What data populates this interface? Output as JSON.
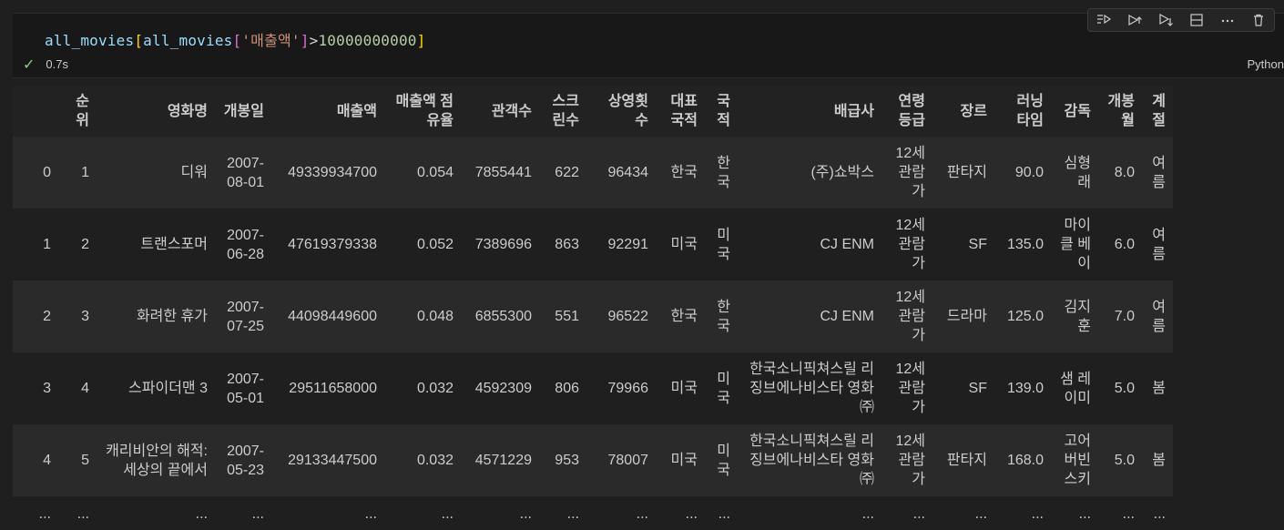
{
  "editor": {
    "code": {
      "v1": "all_movies",
      "b1": "[",
      "v2": "all_movies",
      "b2": "[",
      "s": "'매출액'",
      "b3": "]",
      "op": ">",
      "num": "10000000000",
      "b4": "]"
    },
    "exec_time": "0.7s",
    "language": "Python"
  },
  "toolbar": {
    "icons": [
      "run-by-line-icon",
      "execute-above-icon",
      "execute-below-icon",
      "split-cell-icon",
      "more-icon",
      "delete-icon"
    ]
  },
  "table": {
    "headers": [
      "",
      "순위",
      "영화명",
      "개봉일",
      "매출액",
      "매출액 점유율",
      "관객수",
      "스크 린수",
      "상영횟 수",
      "대표 국적",
      "국 적",
      "배급사",
      "연령 등급",
      "장르",
      "러닝 타임",
      "감독",
      "개봉 월",
      "계 절"
    ],
    "rows": [
      [
        "0",
        "1",
        "디워",
        "2007- 08-01",
        "49339934700",
        "0.054",
        "7855441",
        "622",
        "96434",
        "한국",
        "한 국",
        "(주)쇼박스",
        "12세 관람 가",
        "판타지",
        "90.0",
        "심형 래",
        "8.0",
        "여 름"
      ],
      [
        "1",
        "2",
        "트랜스포머",
        "2007- 06-28",
        "47619379338",
        "0.052",
        "7389696",
        "863",
        "92291",
        "미국",
        "미 국",
        "CJ ENM",
        "12세 관람 가",
        "SF",
        "135.0",
        "마이 클 베 이",
        "6.0",
        "여 름"
      ],
      [
        "2",
        "3",
        "화려한 휴가",
        "2007- 07-25",
        "44098449600",
        "0.048",
        "6855300",
        "551",
        "96522",
        "한국",
        "한 국",
        "CJ ENM",
        "12세 관람 가",
        "드라마",
        "125.0",
        "김지 훈",
        "7.0",
        "여 름"
      ],
      [
        "3",
        "4",
        "스파이더맨 3",
        "2007- 05-01",
        "29511658000",
        "0.032",
        "4592309",
        "806",
        "79966",
        "미국",
        "미 국",
        "한국소니픽쳐스릴 리징브에나비스타 영화㈜",
        "12세 관람 가",
        "SF",
        "139.0",
        "샘 레 이미",
        "5.0",
        "봄"
      ],
      [
        "4",
        "5",
        "캐리비안의 해적: 세상의 끝에서",
        "2007- 05-23",
        "29133447500",
        "0.032",
        "4571229",
        "953",
        "78007",
        "미국",
        "미 국",
        "한국소니픽쳐스릴 리징브에나비스타 영화㈜",
        "12세 관람 가",
        "판타지",
        "168.0",
        "고어 버빈 스키",
        "5.0",
        "봄"
      ]
    ],
    "ellipsis": [
      "...",
      "...",
      "...",
      "...",
      "...",
      "...",
      "...",
      "...",
      "...",
      "...",
      "...",
      "...",
      "...",
      "...",
      "...",
      "...",
      "...",
      "..."
    ]
  }
}
